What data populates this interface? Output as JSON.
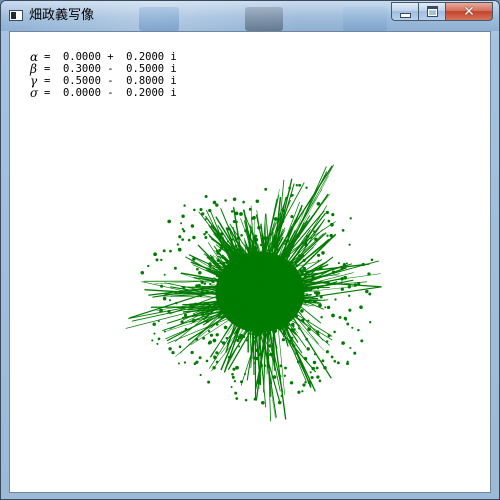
{
  "window": {
    "title": "畑政義写像",
    "controls": {
      "minimize_icon": "minimize-icon",
      "maximize_icon": "maximize-icon",
      "close_icon": "close-icon",
      "close_glyph": "✕"
    }
  },
  "parameters": [
    {
      "symbol": "α",
      "value": "=  0.0000 +  0.2000 i"
    },
    {
      "symbol": "β",
      "value": "=  0.3000 -  0.5000 i"
    },
    {
      "symbol": "γ",
      "value": "=  0.5000 -  0.8000 i"
    },
    {
      "symbol": "σ",
      "value": "=  0.0000 -  0.2000 i"
    }
  ],
  "fractal": {
    "color": "#007a00",
    "background": "#ffffff"
  },
  "colors": {
    "close_button": "#c4432a",
    "titlebar": "#9fbddc"
  }
}
